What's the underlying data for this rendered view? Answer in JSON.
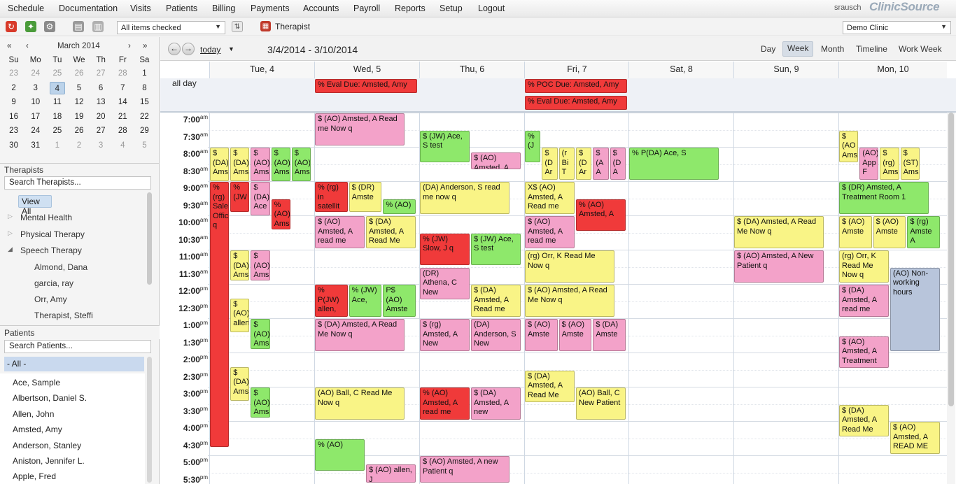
{
  "menu": {
    "items": [
      "Schedule",
      "Documentation",
      "Visits",
      "Patients",
      "Billing",
      "Payments",
      "Accounts",
      "Payroll",
      "Reports",
      "Setup",
      "Logout"
    ],
    "user": "srausch",
    "brand": "ClinicSource"
  },
  "toolbar": {
    "filter": "All items checked",
    "filter_button": "Therapist",
    "clinic": "Demo Clinic",
    "icons": [
      "refresh-icon",
      "leaf-icon",
      "gear-icon",
      "print-icon",
      "page-icon",
      "swap-icon",
      "therapist-icon"
    ]
  },
  "minical": {
    "month": "March 2014",
    "prev_year": "«",
    "prev": "‹",
    "next": "›",
    "next_year": "»",
    "dow": [
      "Su",
      "Mo",
      "Tu",
      "We",
      "Th",
      "Fr",
      "Sa"
    ],
    "weeks": [
      [
        "23",
        "24",
        "25",
        "26",
        "27",
        "28",
        "1"
      ],
      [
        "2",
        "3",
        "4",
        "5",
        "6",
        "7",
        "8"
      ],
      [
        "9",
        "10",
        "11",
        "12",
        "13",
        "14",
        "15"
      ],
      [
        "16",
        "17",
        "18",
        "19",
        "20",
        "21",
        "22"
      ],
      [
        "23",
        "24",
        "25",
        "26",
        "27",
        "28",
        "29"
      ],
      [
        "30",
        "31",
        "1",
        "2",
        "3",
        "4",
        "5"
      ]
    ]
  },
  "therapists": {
    "title": "Therapists",
    "search": "Search Therapists...",
    "view_all": "View All",
    "groups": [
      "Mental Health",
      "Physical Therapy",
      "Speech Therapy"
    ],
    "names": [
      "Almond, Dana",
      "garcia, ray",
      "Orr, Amy",
      "Therapist, Steffi"
    ]
  },
  "patients": {
    "title": "Patients",
    "search": "Search Patients...",
    "all": "- All -",
    "names": [
      "Ace, Sample",
      "Albertson, Daniel S.",
      "Allen, John",
      "Amsted, Amy",
      "Anderson, Stanley",
      "Aniston, Jennifer L.",
      "Apple, Fred"
    ]
  },
  "calendar": {
    "today": "today",
    "range": "3/4/2014 - 3/10/2014",
    "views": [
      "Day",
      "Week",
      "Month",
      "Timeline",
      "Work Week"
    ],
    "active_view": "Week",
    "days": [
      "Tue, 4",
      "Wed, 5",
      "Thu, 6",
      "Fri, 7",
      "Sat, 8",
      "Sun, 9",
      "Mon, 10"
    ],
    "allday_label": "all day",
    "times": [
      [
        "7:00",
        "am"
      ],
      [
        "7:30",
        "am"
      ],
      [
        "8:00",
        "am"
      ],
      [
        "8:30",
        "am"
      ],
      [
        "9:00",
        "am"
      ],
      [
        "9:30",
        "am"
      ],
      [
        "10:00",
        "am"
      ],
      [
        "10:30",
        "am"
      ],
      [
        "11:00",
        "am"
      ],
      [
        "11:30",
        "am"
      ],
      [
        "12:00",
        "pm"
      ],
      [
        "12:30",
        "pm"
      ],
      [
        "1:00",
        "pm"
      ],
      [
        "1:30",
        "pm"
      ],
      [
        "2:00",
        "pm"
      ],
      [
        "2:30",
        "pm"
      ],
      [
        "3:00",
        "pm"
      ],
      [
        "3:30",
        "pm"
      ],
      [
        "4:00",
        "pm"
      ],
      [
        "4:30",
        "pm"
      ],
      [
        "5:00",
        "pm"
      ],
      [
        "5:30",
        "pm"
      ]
    ],
    "allday_events": [
      {
        "day": 1,
        "color": "r",
        "text": "%   Eval Due: Amsted, Amy"
      },
      {
        "day": 3,
        "color": "r",
        "text": "%   POC Due: Amsted, Amy"
      },
      {
        "day": 3,
        "color": "r",
        "text": "%   Eval Due: Amsted, Amy"
      }
    ],
    "colors": {
      "y": "#f9f486",
      "p": "#f3a2c9",
      "g": "#8ee86b",
      "r": "#f03a3a",
      "b": "#b8c5db"
    },
    "events": [
      {
        "day": 0,
        "c": "y",
        "s": 8.0,
        "e": 9.0,
        "col": 0,
        "n": 5,
        "t": "$ (DA) Ams"
      },
      {
        "day": 0,
        "c": "y",
        "s": 8.0,
        "e": 9.0,
        "col": 1,
        "n": 5,
        "t": "$ (DA) Ams"
      },
      {
        "day": 0,
        "c": "p",
        "s": 8.0,
        "e": 9.0,
        "col": 2,
        "n": 5,
        "t": "$ (AO) Ams"
      },
      {
        "day": 0,
        "c": "g",
        "s": 8.0,
        "e": 9.0,
        "col": 3,
        "n": 5,
        "t": "$ (AO) Ams"
      },
      {
        "day": 0,
        "c": "g",
        "s": 8.0,
        "e": 9.0,
        "col": 4,
        "n": 5,
        "t": "$ (AO) Ams"
      },
      {
        "day": 0,
        "c": "r",
        "s": 9.0,
        "e": 16.75,
        "col": 0,
        "n": 5,
        "t": "% (rg) Sale Offic q"
      },
      {
        "day": 0,
        "c": "r",
        "s": 9.0,
        "e": 9.9,
        "col": 1,
        "n": 5,
        "t": "% (JW"
      },
      {
        "day": 0,
        "c": "p",
        "s": 9.0,
        "e": 10.0,
        "col": 2,
        "n": 5,
        "t": "$ (DA) Ace"
      },
      {
        "day": 0,
        "c": "r",
        "s": 9.5,
        "e": 10.4,
        "col": 3,
        "n": 5,
        "t": "% (AO) Ams"
      },
      {
        "day": 0,
        "c": "y",
        "s": 11.0,
        "e": 11.9,
        "col": 1,
        "n": 5,
        "t": "$ (DA) Ams"
      },
      {
        "day": 0,
        "c": "p",
        "s": 11.0,
        "e": 11.9,
        "col": 2,
        "n": 5,
        "t": "$ (AO) Ams"
      },
      {
        "day": 0,
        "c": "y",
        "s": 12.4,
        "e": 13.4,
        "col": 1,
        "n": 5,
        "t": "$ (AO) allen"
      },
      {
        "day": 0,
        "c": "g",
        "s": 13.0,
        "e": 13.9,
        "col": 2,
        "n": 5,
        "t": "$ (AO) Ams"
      },
      {
        "day": 0,
        "c": "y",
        "s": 14.4,
        "e": 15.4,
        "col": 1,
        "n": 5,
        "t": "$ (DA) Ams"
      },
      {
        "day": 0,
        "c": "g",
        "s": 15.0,
        "e": 15.9,
        "col": 2,
        "n": 5,
        "t": "$ (AO) Ams"
      },
      {
        "day": 1,
        "c": "p",
        "s": 7.0,
        "e": 7.95,
        "col": 0,
        "n": 1,
        "w": 0.88,
        "t": "$ (AO) Amsted, A Read me Now    q"
      },
      {
        "day": 1,
        "c": "r",
        "s": 9.0,
        "e": 9.9,
        "col": 0,
        "n": 3,
        "t": "% (rg) in satellit"
      },
      {
        "day": 1,
        "c": "y",
        "s": 9.0,
        "e": 9.9,
        "col": 1,
        "n": 3,
        "t": "$ (DR) Amste"
      },
      {
        "day": 1,
        "c": "g",
        "s": 9.5,
        "e": 9.95,
        "col": 2,
        "n": 3,
        "t": "% (AO)"
      },
      {
        "day": 1,
        "c": "p",
        "s": 10.0,
        "e": 10.95,
        "col": 0,
        "n": 2,
        "t": "$ (AO) Amsted, A read me"
      },
      {
        "day": 1,
        "c": "y",
        "s": 10.0,
        "e": 10.95,
        "col": 1,
        "n": 2,
        "t": "$ (DA) Amsted, A Read Me"
      },
      {
        "day": 1,
        "c": "r",
        "s": 12.0,
        "e": 12.95,
        "col": 0,
        "n": 3,
        "t": "% P(JW) allen,"
      },
      {
        "day": 1,
        "c": "g",
        "s": 12.0,
        "e": 12.95,
        "col": 1,
        "n": 3,
        "t": "% (JW) Ace,"
      },
      {
        "day": 1,
        "c": "g",
        "s": 12.0,
        "e": 12.95,
        "col": 2,
        "n": 3,
        "t": "P$ (AO) Amste"
      },
      {
        "day": 1,
        "c": "p",
        "s": 13.0,
        "e": 13.95,
        "col": 0,
        "n": 1,
        "w": 0.88,
        "t": "$ (DA) Amsted, A Read Me Now    q"
      },
      {
        "day": 1,
        "c": "y",
        "s": 15.0,
        "e": 15.95,
        "col": 0,
        "n": 1,
        "w": 0.88,
        "t": "(AO) Ball, C Read Me Now    q"
      },
      {
        "day": 1,
        "c": "g",
        "s": 16.5,
        "e": 17.45,
        "col": 0,
        "n": 2,
        "t": "%  (AO)"
      },
      {
        "day": 1,
        "c": "p",
        "s": 17.25,
        "e": 17.8,
        "col": 1,
        "n": 2,
        "t": "$ (AO) allen, J"
      },
      {
        "day": 2,
        "c": "g",
        "s": 7.5,
        "e": 8.45,
        "col": 0,
        "n": 2,
        "t": "$ (JW) Ace, S test"
      },
      {
        "day": 2,
        "c": "p",
        "s": 8.15,
        "e": 8.65,
        "col": 1,
        "n": 2,
        "t": "$ (AO) Amsted, A"
      },
      {
        "day": 2,
        "c": "y",
        "s": 9.0,
        "e": 9.95,
        "col": 0,
        "n": 1,
        "w": 0.88,
        "t": "(DA) Anderson, S read me now    q"
      },
      {
        "day": 2,
        "c": "r",
        "s": 10.5,
        "e": 11.45,
        "col": 0,
        "n": 2,
        "t": "%  (JW) Slow, J   q"
      },
      {
        "day": 2,
        "c": "g",
        "s": 10.5,
        "e": 11.45,
        "col": 1,
        "n": 2,
        "t": "$ (JW) Ace, S test"
      },
      {
        "day": 2,
        "c": "p",
        "s": 11.5,
        "e": 12.45,
        "col": 0,
        "n": 2,
        "t": "(DR) Athena, C New"
      },
      {
        "day": 2,
        "c": "y",
        "s": 12.0,
        "e": 12.95,
        "col": 1,
        "n": 2,
        "t": "$ (DA) Amsted, A Read me"
      },
      {
        "day": 2,
        "c": "p",
        "s": 13.0,
        "e": 13.95,
        "col": 0,
        "n": 2,
        "t": "$ (rg) Amsted, A New"
      },
      {
        "day": 2,
        "c": "p",
        "s": 13.0,
        "e": 13.95,
        "col": 1,
        "n": 2,
        "t": "(DA) Anderson, S New"
      },
      {
        "day": 2,
        "c": "r",
        "s": 15.0,
        "e": 15.95,
        "col": 0,
        "n": 2,
        "t": "%  (AO) Amsted, A read me"
      },
      {
        "day": 2,
        "c": "p",
        "s": 15.0,
        "e": 15.95,
        "col": 1,
        "n": 2,
        "t": "$ (DA) Amsted, A new"
      },
      {
        "day": 2,
        "c": "p",
        "s": 17.0,
        "e": 17.8,
        "col": 0,
        "n": 1,
        "w": 0.88,
        "t": "$ (AO) Amsted, A new Patient    q"
      },
      {
        "day": 3,
        "c": "g",
        "s": 7.5,
        "e": 8.45,
        "col": 0,
        "n": 6,
        "t": "% (J"
      },
      {
        "day": 3,
        "c": "y",
        "s": 8.0,
        "e": 8.95,
        "col": 1,
        "n": 6,
        "t": "$ (D Ar"
      },
      {
        "day": 3,
        "c": "y",
        "s": 8.0,
        "e": 8.95,
        "col": 2,
        "n": 6,
        "t": "(r Bi T"
      },
      {
        "day": 3,
        "c": "y",
        "s": 8.0,
        "e": 8.95,
        "col": 3,
        "n": 6,
        "t": "$ (D Ar"
      },
      {
        "day": 3,
        "c": "p",
        "s": 8.0,
        "e": 8.95,
        "col": 4,
        "n": 6,
        "t": "$ (A A"
      },
      {
        "day": 3,
        "c": "p",
        "s": 8.0,
        "e": 8.95,
        "col": 5,
        "n": 6,
        "t": "$ (D A"
      },
      {
        "day": 3,
        "c": "y",
        "s": 9.0,
        "e": 9.95,
        "col": 0,
        "n": 2,
        "t": "X$ (AO) Amsted, A Read me"
      },
      {
        "day": 3,
        "c": "r",
        "s": 9.5,
        "e": 10.45,
        "col": 1,
        "n": 2,
        "t": "%  (AO) Amsted, A"
      },
      {
        "day": 3,
        "c": "p",
        "s": 10.0,
        "e": 10.95,
        "col": 0,
        "n": 2,
        "t": "$ (AO) Amsted, A read me"
      },
      {
        "day": 3,
        "c": "y",
        "s": 11.0,
        "e": 11.95,
        "col": 0,
        "n": 1,
        "w": 0.88,
        "t": "(rg) Orr, K Read Me Now    q"
      },
      {
        "day": 3,
        "c": "y",
        "s": 12.0,
        "e": 12.95,
        "col": 0,
        "n": 1,
        "w": 0.88,
        "t": "$ (AO) Amsted, A Read Me Now    q"
      },
      {
        "day": 3,
        "c": "p",
        "s": 13.0,
        "e": 13.95,
        "col": 0,
        "n": 3,
        "t": "$ (AO) Amste"
      },
      {
        "day": 3,
        "c": "p",
        "s": 13.0,
        "e": 13.95,
        "col": 1,
        "n": 3,
        "t": "$ (AO) Amste"
      },
      {
        "day": 3,
        "c": "p",
        "s": 13.0,
        "e": 13.95,
        "col": 2,
        "n": 3,
        "t": "$ (DA) Amste"
      },
      {
        "day": 3,
        "c": "y",
        "s": 14.5,
        "e": 15.45,
        "col": 0,
        "n": 2,
        "t": "$ (DA) Amsted, A Read Me"
      },
      {
        "day": 3,
        "c": "y",
        "s": 15.0,
        "e": 15.95,
        "col": 1,
        "n": 2,
        "t": "(AO) Ball, C New Patient"
      },
      {
        "day": 4,
        "c": "g",
        "s": 8.0,
        "e": 8.95,
        "col": 0,
        "n": 1,
        "w": 0.88,
        "t": "%  P(DA) Ace, S"
      },
      {
        "day": 5,
        "c": "y",
        "s": 10.0,
        "e": 10.95,
        "col": 0,
        "n": 1,
        "w": 0.88,
        "t": "$ (DA) Amsted, A Read Me Now    q"
      },
      {
        "day": 5,
        "c": "p",
        "s": 11.0,
        "e": 11.95,
        "col": 0,
        "n": 1,
        "w": 0.88,
        "t": "$ (AO) Amsted, A New Patient    q"
      },
      {
        "day": 6,
        "c": "y",
        "s": 7.5,
        "e": 8.45,
        "col": 0,
        "n": 5,
        "t": "$ (AO Ams"
      },
      {
        "day": 6,
        "c": "p",
        "s": 8.0,
        "e": 8.95,
        "col": 1,
        "n": 5,
        "t": "(AO) App F"
      },
      {
        "day": 6,
        "c": "y",
        "s": 8.0,
        "e": 8.95,
        "col": 2,
        "n": 5,
        "t": "$ (rg) Ams"
      },
      {
        "day": 6,
        "c": "y",
        "s": 8.0,
        "e": 8.95,
        "col": 3,
        "n": 5,
        "t": "$ (ST) Ams"
      },
      {
        "day": 6,
        "c": "g",
        "s": 9.0,
        "e": 9.95,
        "col": 0,
        "n": 1,
        "w": 0.88,
        "t": "$ (DR) Amsted, A Treatment Room 1"
      },
      {
        "day": 6,
        "c": "y",
        "s": 10.0,
        "e": 10.95,
        "col": 0,
        "n": 3,
        "t": "$ (AO) Amste"
      },
      {
        "day": 6,
        "c": "y",
        "s": 10.0,
        "e": 10.95,
        "col": 1,
        "n": 3,
        "t": "$ (AO) Amste"
      },
      {
        "day": 6,
        "c": "g",
        "s": 10.0,
        "e": 10.95,
        "col": 2,
        "n": 3,
        "t": "$ (rg) Amste A"
      },
      {
        "day": 6,
        "c": "y",
        "s": 11.0,
        "e": 11.95,
        "col": 0,
        "n": 2,
        "t": "(rg) Orr, K Read Me Now    q"
      },
      {
        "day": 6,
        "c": "b",
        "s": 11.5,
        "e": 13.95,
        "col": 1,
        "n": 2,
        "t": "(AO) Non-working hours"
      },
      {
        "day": 6,
        "c": "p",
        "s": 12.0,
        "e": 12.95,
        "col": 0,
        "n": 2,
        "t": "$ (DA) Amsted, A read me"
      },
      {
        "day": 6,
        "c": "p",
        "s": 13.5,
        "e": 14.45,
        "col": 0,
        "n": 2,
        "t": "$ (AO) Amsted, A Treatment"
      },
      {
        "day": 6,
        "c": "y",
        "s": 15.5,
        "e": 16.45,
        "col": 0,
        "n": 2,
        "t": "$ (DA) Amsted, A Read Me"
      },
      {
        "day": 6,
        "c": "y",
        "s": 16.0,
        "e": 16.95,
        "col": 1,
        "n": 2,
        "t": "$ (AO) Amsted, A READ ME"
      }
    ]
  }
}
